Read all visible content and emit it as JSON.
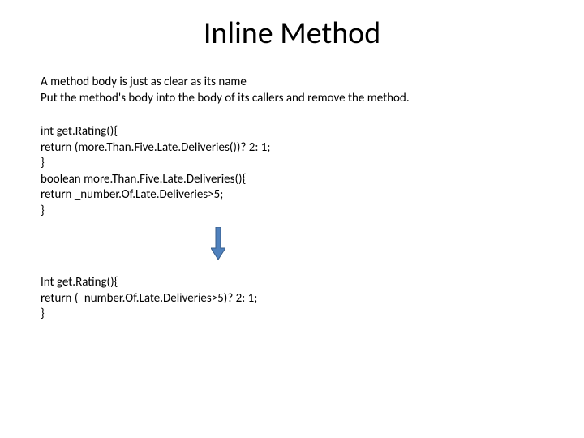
{
  "title": "Inline Method",
  "description": {
    "line1": "A method body is just as clear as its name",
    "line2": "Put the method's body into the body of its callers and remove the method."
  },
  "code_before": {
    "l1": "int get.Rating(){",
    "l2": "return (more.Than.Five.Late.Deliveries())? 2: 1;",
    "l3": "}",
    "l4": "boolean more.Than.Five.Late.Deliveries(){",
    "l5": "return _number.Of.Late.Deliveries>5;",
    "l6": "}"
  },
  "code_after": {
    "l1": "Int get.Rating(){",
    "l2": "return (_number.Of.Late.Deliveries>5)? 2: 1;",
    "l3": "}"
  },
  "arrow": {
    "fill": "#4F81BD",
    "stroke": "#385D8A"
  }
}
